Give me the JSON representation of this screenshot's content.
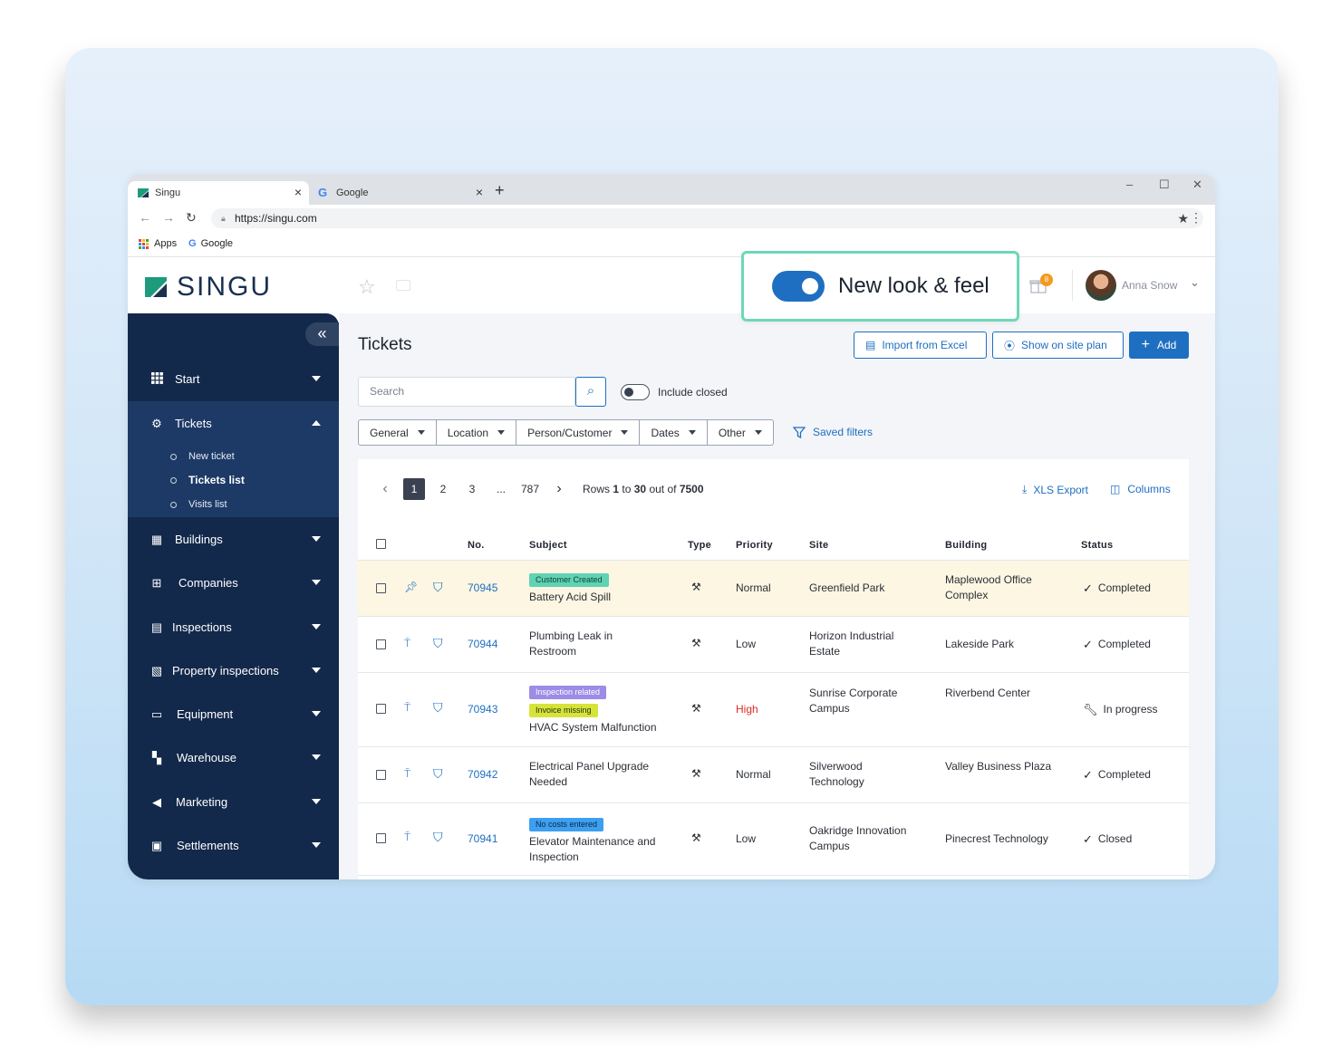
{
  "browser": {
    "tabs": [
      {
        "label": "Singu"
      },
      {
        "label": "Google"
      }
    ],
    "url": "https://singu.com",
    "bookmarks": [
      {
        "label": "Apps"
      },
      {
        "label": "Google"
      }
    ]
  },
  "header": {
    "logo_text": "SINGU",
    "notification_count": "8",
    "user_name": "Anna Snow"
  },
  "feature_toggle": {
    "label": "New look & feel",
    "enabled": true
  },
  "sidebar": {
    "items": [
      {
        "label": "Start",
        "icon": "grid-icon"
      },
      {
        "label": "Tickets",
        "icon": "gear-icon",
        "expanded": true
      },
      {
        "label": "Buildings",
        "icon": "building-icon"
      },
      {
        "label": "Companies",
        "icon": "companies-icon"
      },
      {
        "label": "Inspections",
        "icon": "clipboard-icon"
      },
      {
        "label": "Property inspections",
        "icon": "document-icon"
      },
      {
        "label": "Equipment",
        "icon": "equipment-icon"
      },
      {
        "label": "Warehouse",
        "icon": "boxes-icon"
      },
      {
        "label": "Marketing",
        "icon": "megaphone-icon"
      },
      {
        "label": "Settlements",
        "icon": "money-icon"
      }
    ],
    "ticket_subitems": [
      {
        "label": "New ticket"
      },
      {
        "label": "Tickets list",
        "active": true
      },
      {
        "label": "Visits list"
      }
    ]
  },
  "page": {
    "title": "Tickets",
    "import_label": "Import from Excel",
    "site_plan_label": "Show on site plan",
    "add_label": "Add",
    "search_placeholder": "Search",
    "include_closed_label": "Include closed",
    "filters": [
      "General",
      "Location",
      "Person/Customer",
      "Dates",
      "Other"
    ],
    "saved_filters_label": "Saved filters"
  },
  "pagination": {
    "pages": [
      "1",
      "2",
      "3",
      "...",
      "787"
    ],
    "current": "1",
    "rows_prefix": "Rows",
    "rows_from": "1",
    "rows_to_word": "to",
    "rows_to": "30",
    "rows_outof_word": "out of",
    "rows_total": "7500",
    "xls_export_label": "XLS Export",
    "columns_label": "Columns"
  },
  "table": {
    "columns": [
      "No.",
      "Subject",
      "Type",
      "Priority",
      "Site",
      "Building",
      "Status"
    ],
    "rows": [
      {
        "no": "70945",
        "tags": [
          {
            "text": "Customer Created",
            "bg": "#5fd3b3",
            "fg": "#0f3d33"
          }
        ],
        "subject": "Battery Acid Spill",
        "priority": "Normal",
        "site": "Greenfield Park",
        "building": "Maplewood Office Complex",
        "status": "Completed",
        "status_icon": "check-icon",
        "highlight": true
      },
      {
        "no": "70944",
        "tags": [],
        "subject": "Plumbing Leak in Restroom",
        "priority": "Low",
        "site": "Horizon Industrial Estate",
        "building": "Lakeside Park",
        "status": "Completed",
        "status_icon": "check-icon"
      },
      {
        "no": "70943",
        "tags": [
          {
            "text": "Inspection related",
            "bg": "#9c8ce6",
            "fg": "#ffffff"
          },
          {
            "text": "Invoice missing",
            "bg": "#d6e43a",
            "fg": "#2b2f10"
          }
        ],
        "subject": "HVAC System Malfunction",
        "priority": "High",
        "site": "Sunrise Corporate Campus",
        "building": "Riverbend Center",
        "status": "In progress",
        "status_icon": "wrench-icon"
      },
      {
        "no": "70942",
        "tags": [],
        "subject": "Electrical Panel Upgrade Needed",
        "priority": "Normal",
        "site": "Silverwood Technology",
        "building": "Valley Business Plaza",
        "status": "Completed",
        "status_icon": "check-icon"
      },
      {
        "no": "70941",
        "tags": [
          {
            "text": "No costs entered",
            "bg": "#3d9ff0",
            "fg": "#0b2745"
          }
        ],
        "subject": "Elevator Maintenance and Inspection",
        "priority": "Low",
        "site": "Oakridge Innovation Campus",
        "building": "Pinecrest Technology",
        "status": "Closed",
        "status_icon": "double-check-icon"
      }
    ]
  },
  "colors": {
    "brand": "#13294b",
    "accent": "#1e6fc1",
    "highlight_border": "#6fd6b9",
    "row_highlight": "#fcf6e2"
  }
}
